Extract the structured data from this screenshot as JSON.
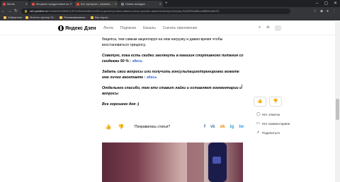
{
  "browser": {
    "tabs": [
      {
        "title": "Меню"
      },
      {
        "title": "Мощные продуктовые ко..."
      },
      {
        "title": "Бег суперсил, помним ..."
      },
      {
        "title": "Новая вкладка"
      }
    ],
    "new_tab": "+",
    "url_host": "zen.yandex.ru",
    "url_rest": "/media/id/5c8b9fc19f74d/6c9dd46c2cfd0d-superset-prostoi-nadezd-uzhar-sposob-nakachat-biceps-tricepsy-5d6259b486ccd6f6f3ee6e33",
    "bookmarks": [
      "Избранное",
      "Фитнес-тренер 20...",
      "Распаковываем...",
      "Как научи..."
    ]
  },
  "header": {
    "logo_text": "Яндекс Дзен",
    "menu": [
      "Лента",
      "Подписки",
      "Каналы",
      "Скачать приложение"
    ]
  },
  "article": {
    "p1": "бицепса, тем самым акцентируя на нем нагрузку и давая время чтобы восстановиться трицепсу.",
    "p2_text": "Советую, пока есть скидки заглянуть в магазин спортивного питания со скидками 50 % :",
    "p2_link": "здесь",
    "p3_text": "Задать свои вопросы или получить консультацию/тренировки можете мне лично вконтакте :",
    "p3_link": "здесь",
    "p4": "Отдельное спасибо, тем кто ставит лайки и оставляет комментарии и вопросы",
    "p5": "Все хорошего дня :)"
  },
  "actions": {
    "like": "👍",
    "dislike": "👎",
    "question": "Понравилась статья?",
    "shares": [
      {
        "label": "f",
        "color": "#3b5998"
      },
      {
        "label": "vk",
        "color": "#4a76a8"
      },
      {
        "label": "ok",
        "color": "#ee8208"
      },
      {
        "label": "tg",
        "color": "#2aa3df"
      },
      {
        "label": "tw",
        "color": "#1da1f2"
      }
    ]
  },
  "side": {
    "items": [
      {
        "icon": "◯",
        "label": "Нет отметок"
      },
      {
        "icon": "▭",
        "label": "Нет комментариев"
      },
      {
        "icon": "↗",
        "label": "Поделиться"
      }
    ]
  }
}
